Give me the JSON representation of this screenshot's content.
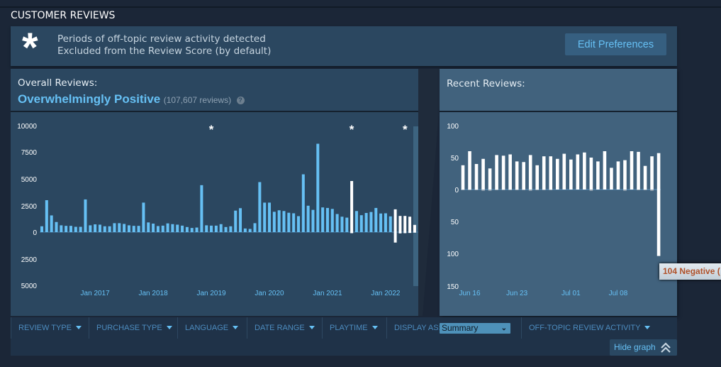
{
  "section_title": "CUSTOMER REVIEWS",
  "notice": {
    "icon": "asterisk-icon",
    "symbol": "*",
    "line1": "Periods of off-topic review activity detected",
    "line2": "Excluded from the Review Score (by default)",
    "edit_button": "Edit Preferences"
  },
  "overall": {
    "label": "Overall Reviews:",
    "score": "Overwhelmingly Positive",
    "count": "(107,607 reviews)",
    "help": "?"
  },
  "recent": {
    "label": "Recent Reviews:"
  },
  "filters": {
    "items": [
      "REVIEW TYPE",
      "PURCHASE TYPE",
      "LANGUAGE",
      "DATE RANGE",
      "PLAYTIME"
    ],
    "display_as_label": "DISPLAY AS:",
    "display_as_value": "Summary",
    "off_topic": "OFF-TOPIC REVIEW ACTIVITY",
    "hide_graph": "Hide graph"
  },
  "tooltip": "104 Negative (",
  "colors": {
    "positive_bar": "#66c0f4",
    "highlight_bar": "#ffffff",
    "accent_text": "#66c0f4",
    "negative_tooltip": "#b0522a"
  },
  "chart_data": [
    {
      "type": "bar",
      "y_ticks": [
        "10000",
        "7500",
        "5000",
        "2500",
        "0",
        "2500",
        "5000"
      ],
      "ylim": [
        -5000,
        10000
      ],
      "x_tick_labels": [
        "Jan 2017",
        "Jan 2018",
        "Jan 2019",
        "Jan 2020",
        "Jan 2021",
        "Jan 2022"
      ],
      "x": [
        "2016-02",
        "2016-03",
        "2016-04",
        "2016-05",
        "2016-06",
        "2016-07",
        "2016-08",
        "2016-09",
        "2016-10",
        "2016-11",
        "2016-12",
        "2017-01",
        "2017-02",
        "2017-03",
        "2017-04",
        "2017-05",
        "2017-06",
        "2017-07",
        "2017-08",
        "2017-09",
        "2017-10",
        "2017-11",
        "2017-12",
        "2018-01",
        "2018-02",
        "2018-03",
        "2018-04",
        "2018-05",
        "2018-06",
        "2018-07",
        "2018-08",
        "2018-09",
        "2018-10",
        "2018-11",
        "2018-12",
        "2019-01",
        "2019-02",
        "2019-03",
        "2019-04",
        "2019-05",
        "2019-06",
        "2019-07",
        "2019-08",
        "2019-09",
        "2019-10",
        "2019-11",
        "2019-12",
        "2020-01",
        "2020-02",
        "2020-03",
        "2020-04",
        "2020-05",
        "2020-06",
        "2020-07",
        "2020-08",
        "2020-09",
        "2020-10",
        "2020-11",
        "2020-12",
        "2021-01",
        "2021-02",
        "2021-03",
        "2021-04",
        "2021-05",
        "2021-06",
        "2021-07",
        "2021-08",
        "2021-09",
        "2021-10",
        "2021-11",
        "2021-12",
        "2022-01",
        "2022-02",
        "2022-03",
        "2022-04",
        "2022-05",
        "2022-06",
        "2022-07"
      ],
      "positive": [
        550,
        3000,
        1570,
        950,
        640,
        590,
        590,
        500,
        500,
        3070,
        640,
        730,
        700,
        550,
        550,
        840,
        840,
        770,
        640,
        590,
        590,
        2770,
        910,
        800,
        570,
        610,
        820,
        750,
        700,
        610,
        480,
        390,
        430,
        4410,
        640,
        610,
        610,
        750,
        480,
        550,
        2020,
        2250,
        340,
        300,
        840,
        4700,
        2770,
        2770,
        1910,
        2050,
        1980,
        1820,
        1770,
        1500,
        5430,
        2480,
        2090,
        8300,
        2320,
        2270,
        2180,
        1700,
        1450,
        1360,
        4800,
        1980,
        1590,
        1800,
        1890,
        2270,
        1750,
        1770,
        1480,
        2140,
        1520,
        1520,
        1450,
        680
      ],
      "negative": [
        0,
        0,
        0,
        0,
        0,
        0,
        0,
        0,
        0,
        0,
        0,
        0,
        0,
        0,
        0,
        0,
        0,
        0,
        0,
        0,
        0,
        0,
        0,
        0,
        0,
        0,
        0,
        0,
        0,
        0,
        0,
        0,
        0,
        0,
        0,
        0,
        0,
        0,
        0,
        0,
        0,
        0,
        0,
        0,
        0,
        0,
        0,
        0,
        0,
        0,
        0,
        0,
        0,
        0,
        0,
        0,
        0,
        0,
        0,
        0,
        0,
        0,
        0,
        0,
        100,
        0,
        0,
        0,
        0,
        0,
        0,
        0,
        0,
        980,
        120,
        100,
        80,
        50
      ],
      "highlighted": [
        "2021-06",
        "2022-03",
        "2022-04",
        "2022-05",
        "2022-06",
        "2022-07"
      ],
      "off_topic_markers": [
        "2019-01",
        "2021-06",
        "2022-05"
      ]
    },
    {
      "type": "bar",
      "y_ticks": [
        "100",
        "50",
        "0",
        "50",
        "100",
        "150"
      ],
      "ylim": [
        -150,
        100
      ],
      "x_tick_labels": [
        "Jun 16",
        "Jun 23",
        "Jul 01",
        "Jul 08"
      ],
      "x": [
        "Jun 15",
        "Jun 16",
        "Jun 17",
        "Jun 18",
        "Jun 19",
        "Jun 20",
        "Jun 21",
        "Jun 22",
        "Jun 23",
        "Jun 24",
        "Jun 25",
        "Jun 26",
        "Jun 27",
        "Jun 28",
        "Jun 29",
        "Jun 30",
        "Jul 01",
        "Jul 02",
        "Jul 03",
        "Jul 04",
        "Jul 05",
        "Jul 06",
        "Jul 07",
        "Jul 08",
        "Jul 09",
        "Jul 10",
        "Jul 11",
        "Jul 12",
        "Jul 13",
        "Jul 14"
      ],
      "positive": [
        38,
        60,
        40,
        48,
        33,
        54,
        53,
        55,
        44,
        43,
        54,
        38,
        52,
        52,
        48,
        56,
        47,
        55,
        58,
        50,
        44,
        60,
        34,
        44,
        46,
        60,
        59,
        37,
        52,
        57
      ],
      "negative": [
        1,
        1,
        1,
        2,
        2,
        1,
        1,
        1,
        1,
        1,
        2,
        1,
        1,
        1,
        0,
        0,
        0,
        0,
        0,
        2,
        0,
        0,
        0,
        0,
        2,
        0,
        1,
        1,
        2,
        104
      ]
    }
  ]
}
